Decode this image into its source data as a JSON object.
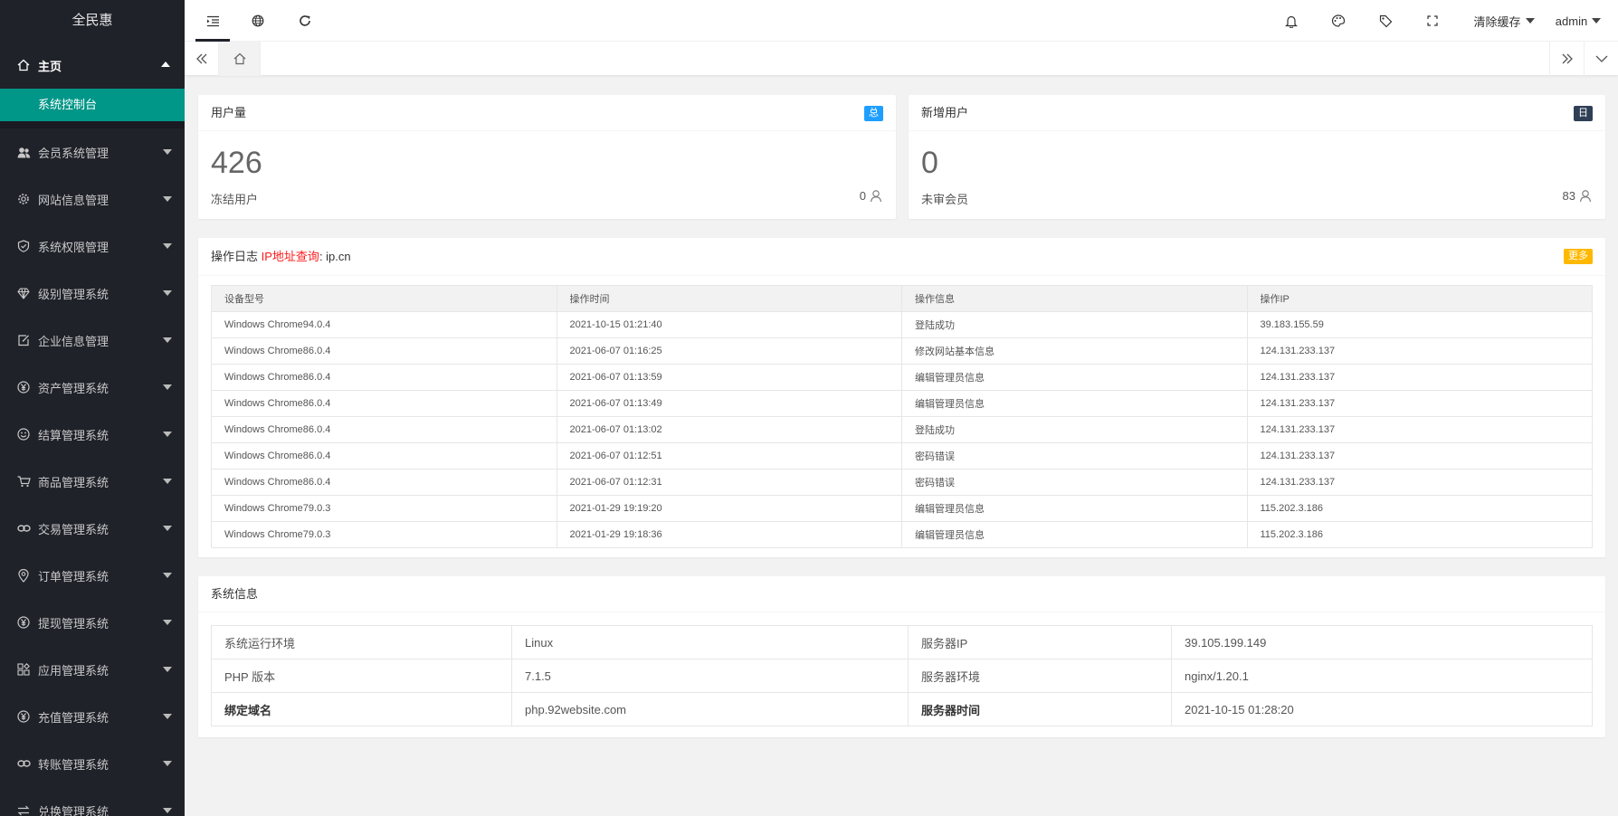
{
  "sidebar": {
    "brand": "全民惠",
    "home": {
      "label": "主页",
      "icon": "home-icon"
    },
    "active_sub": "系统控制台",
    "items": [
      {
        "label": "会员系统管理",
        "icon": "users-icon"
      },
      {
        "label": "网站信息管理",
        "icon": "settings-icon"
      },
      {
        "label": "系统权限管理",
        "icon": "shield-icon"
      },
      {
        "label": "级别管理系统",
        "icon": "diamond-icon"
      },
      {
        "label": "企业信息管理",
        "icon": "edit-icon"
      },
      {
        "label": "资产管理系统",
        "icon": "yen-icon"
      },
      {
        "label": "结算管理系统",
        "icon": "smile-icon"
      },
      {
        "label": "商品管理系统",
        "icon": "cart-icon"
      },
      {
        "label": "交易管理系统",
        "icon": "link-icon"
      },
      {
        "label": "订单管理系统",
        "icon": "location-icon"
      },
      {
        "label": "提现管理系统",
        "icon": "yen-icon"
      },
      {
        "label": "应用管理系统",
        "icon": "apps-icon"
      },
      {
        "label": "充值管理系统",
        "icon": "yen-icon"
      },
      {
        "label": "转账管理系统",
        "icon": "link-icon"
      },
      {
        "label": "兑换管理系统",
        "icon": "exchange-icon"
      }
    ]
  },
  "header": {
    "clear_cache": "清除缓存",
    "user": "admin"
  },
  "cards": {
    "users": {
      "title": "用户量",
      "badge": "总",
      "count": "426",
      "sub_label": "冻结用户",
      "sub_value": "0"
    },
    "new_users": {
      "title": "新增用户",
      "badge": "日",
      "count": "0",
      "sub_label": "未审会员",
      "sub_value": "83"
    }
  },
  "log": {
    "title": "操作日志",
    "ip_link": "IP地址查询",
    "ip_site": ": ip.cn",
    "more": "更多",
    "columns": [
      "设备型号",
      "操作时间",
      "操作信息",
      "操作IP"
    ],
    "rows": [
      [
        "Windows Chrome94.0.4",
        "2021-10-15 01:21:40",
        "登陆成功",
        "39.183.155.59"
      ],
      [
        "Windows Chrome86.0.4",
        "2021-06-07 01:16:25",
        "修改网站基本信息",
        "124.131.233.137"
      ],
      [
        "Windows Chrome86.0.4",
        "2021-06-07 01:13:59",
        "编辑管理员信息",
        "124.131.233.137"
      ],
      [
        "Windows Chrome86.0.4",
        "2021-06-07 01:13:49",
        "编辑管理员信息",
        "124.131.233.137"
      ],
      [
        "Windows Chrome86.0.4",
        "2021-06-07 01:13:02",
        "登陆成功",
        "124.131.233.137"
      ],
      [
        "Windows Chrome86.0.4",
        "2021-06-07 01:12:51",
        "密码错误",
        "124.131.233.137"
      ],
      [
        "Windows Chrome86.0.4",
        "2021-06-07 01:12:31",
        "密码错误",
        "124.131.233.137"
      ],
      [
        "Windows Chrome79.0.3",
        "2021-01-29 19:19:20",
        "编辑管理员信息",
        "115.202.3.186"
      ],
      [
        "Windows Chrome79.0.3",
        "2021-01-29 19:18:36",
        "编辑管理员信息",
        "115.202.3.186"
      ]
    ]
  },
  "sysinfo": {
    "title": "系统信息",
    "rows": [
      [
        "系统运行环境",
        "Linux",
        "服务器IP",
        "39.105.199.149"
      ],
      [
        "PHP 版本",
        "7.1.5",
        "服务器环境",
        "nginx/1.20.1"
      ],
      [
        "绑定域名",
        "php.92website.com",
        "服务器时间",
        "2021-10-15 01:28:20"
      ]
    ]
  },
  "colors": {
    "sidebar_bg": "#20222a",
    "active_green": "#009688",
    "badge_blue": "#1E9FFF",
    "badge_dark": "#2F4056",
    "badge_yellow": "#FFB800",
    "link_red": "#ff1a1a"
  }
}
